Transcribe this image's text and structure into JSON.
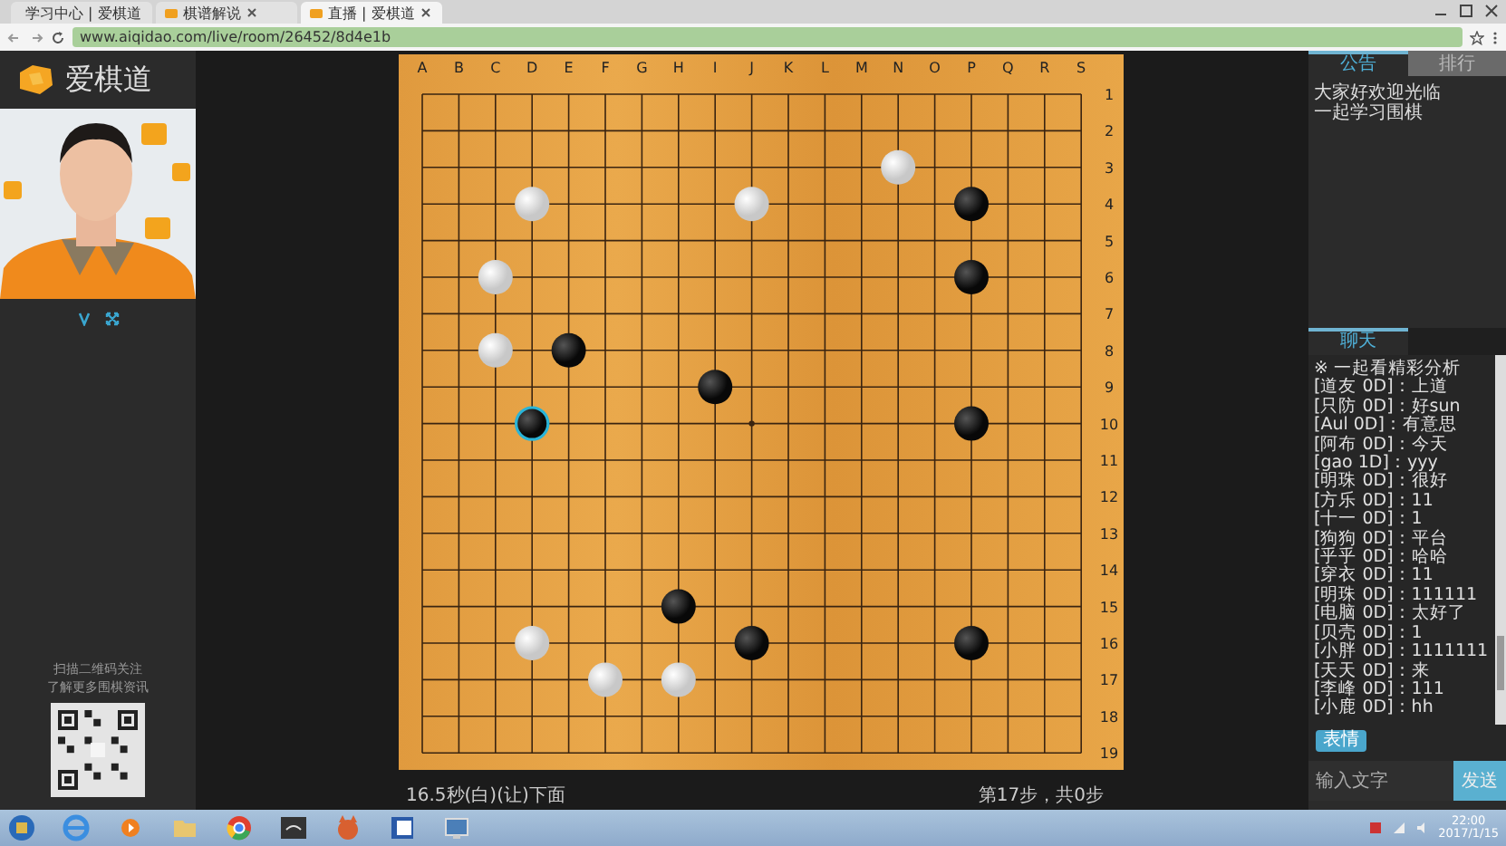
{
  "browser": {
    "tabs": [
      {
        "title": "学习中心 | 爱棋道",
        "selected": false
      },
      {
        "title": "棋谱解说",
        "selected": false
      },
      {
        "title": "直播 | 爱棋道",
        "selected": true
      }
    ],
    "address": "www.aiqidao.com/live/room/26452/8d4e1b"
  },
  "left_panel": {
    "logo": "爱棋道",
    "video": {
      "kind": "picture"
    },
    "qr_caption": [
      "扫描二维码关注",
      "了解更多围棋资讯"
    ]
  },
  "board": {
    "columns": [
      "A",
      "B",
      "C",
      "D",
      "E",
      "F",
      "G",
      "H",
      "I",
      "J",
      "K",
      "L",
      "M",
      "N",
      "O",
      "P",
      "Q",
      "R",
      "S"
    ],
    "rows": [
      "1",
      "2",
      "3",
      "4",
      "5",
      "6",
      "7",
      "8",
      "9",
      "10",
      "11",
      "12",
      "13",
      "14",
      "15",
      "16",
      "17",
      "18",
      "19"
    ],
    "grid": [
      {
        "points": [
          {
            "kind": "empty"
          },
          {
            "kind": "empty"
          },
          {
            "kind": "empty"
          },
          {
            "kind": "empty"
          },
          {
            "kind": "empty"
          },
          {
            "kind": "empty"
          },
          {
            "kind": "empty"
          },
          {
            "kind": "empty"
          },
          {
            "kind": "empty"
          },
          {
            "kind": "empty"
          },
          {
            "kind": "empty"
          },
          {
            "kind": "empty"
          },
          {
            "kind": "empty"
          },
          {
            "kind": "empty"
          },
          {
            "kind": "empty"
          },
          {
            "kind": "empty"
          },
          {
            "kind": "empty"
          },
          {
            "kind": "empty"
          },
          {
            "kind": "empty"
          }
        ]
      },
      {
        "points": [
          {
            "kind": "empty"
          },
          {
            "kind": "empty"
          },
          {
            "kind": "empty"
          },
          {
            "kind": "empty"
          },
          {
            "kind": "empty"
          },
          {
            "kind": "empty"
          },
          {
            "kind": "empty"
          },
          {
            "kind": "empty"
          },
          {
            "kind": "empty"
          },
          {
            "kind": "empty"
          },
          {
            "kind": "empty"
          },
          {
            "kind": "empty"
          },
          {
            "kind": "empty"
          },
          {
            "kind": "empty"
          },
          {
            "kind": "empty"
          },
          {
            "kind": "empty"
          },
          {
            "kind": "empty"
          },
          {
            "kind": "empty"
          },
          {
            "kind": "empty"
          }
        ]
      },
      {
        "points": [
          {
            "kind": "empty"
          },
          {
            "kind": "empty"
          },
          {
            "kind": "empty"
          },
          {
            "kind": "empty"
          },
          {
            "kind": "empty"
          },
          {
            "kind": "empty"
          },
          {
            "kind": "empty"
          },
          {
            "kind": "empty"
          },
          {
            "kind": "empty"
          },
          {
            "kind": "empty"
          },
          {
            "kind": "empty"
          },
          {
            "kind": "empty"
          },
          {
            "kind": "empty"
          },
          {
            "kind": "white"
          },
          {
            "kind": "empty"
          },
          {
            "kind": "empty"
          },
          {
            "kind": "empty"
          },
          {
            "kind": "empty"
          },
          {
            "kind": "empty"
          }
        ]
      },
      {
        "points": [
          {
            "kind": "empty"
          },
          {
            "kind": "empty"
          },
          {
            "kind": "empty"
          },
          {
            "kind": "white"
          },
          {
            "kind": "empty"
          },
          {
            "kind": "empty"
          },
          {
            "kind": "empty"
          },
          {
            "kind": "empty"
          },
          {
            "kind": "empty"
          },
          {
            "kind": "white"
          },
          {
            "kind": "empty"
          },
          {
            "kind": "empty"
          },
          {
            "kind": "empty"
          },
          {
            "kind": "empty"
          },
          {
            "kind": "empty"
          },
          {
            "kind": "black"
          },
          {
            "kind": "empty"
          },
          {
            "kind": "empty"
          },
          {
            "kind": "empty"
          }
        ]
      },
      {
        "points": [
          {
            "kind": "empty"
          },
          {
            "kind": "empty"
          },
          {
            "kind": "empty"
          },
          {
            "kind": "empty"
          },
          {
            "kind": "empty"
          },
          {
            "kind": "empty"
          },
          {
            "kind": "empty"
          },
          {
            "kind": "empty"
          },
          {
            "kind": "empty"
          },
          {
            "kind": "empty"
          },
          {
            "kind": "empty"
          },
          {
            "kind": "empty"
          },
          {
            "kind": "empty"
          },
          {
            "kind": "empty"
          },
          {
            "kind": "empty"
          },
          {
            "kind": "empty"
          },
          {
            "kind": "empty"
          },
          {
            "kind": "empty"
          },
          {
            "kind": "empty"
          }
        ]
      },
      {
        "points": [
          {
            "kind": "empty"
          },
          {
            "kind": "empty"
          },
          {
            "kind": "white"
          },
          {
            "kind": "empty"
          },
          {
            "kind": "empty"
          },
          {
            "kind": "empty"
          },
          {
            "kind": "empty"
          },
          {
            "kind": "empty"
          },
          {
            "kind": "empty"
          },
          {
            "kind": "empty"
          },
          {
            "kind": "empty"
          },
          {
            "kind": "empty"
          },
          {
            "kind": "empty"
          },
          {
            "kind": "empty"
          },
          {
            "kind": "empty"
          },
          {
            "kind": "black"
          },
          {
            "kind": "empty"
          },
          {
            "kind": "empty"
          },
          {
            "kind": "empty"
          }
        ]
      },
      {
        "points": [
          {
            "kind": "empty"
          },
          {
            "kind": "empty"
          },
          {
            "kind": "empty"
          },
          {
            "kind": "empty"
          },
          {
            "kind": "empty"
          },
          {
            "kind": "empty"
          },
          {
            "kind": "empty"
          },
          {
            "kind": "empty"
          },
          {
            "kind": "empty"
          },
          {
            "kind": "empty"
          },
          {
            "kind": "empty"
          },
          {
            "kind": "empty"
          },
          {
            "kind": "empty"
          },
          {
            "kind": "empty"
          },
          {
            "kind": "empty"
          },
          {
            "kind": "empty"
          },
          {
            "kind": "empty"
          },
          {
            "kind": "empty"
          },
          {
            "kind": "empty"
          }
        ]
      },
      {
        "points": [
          {
            "kind": "empty"
          },
          {
            "kind": "empty"
          },
          {
            "kind": "white"
          },
          {
            "kind": "empty"
          },
          {
            "kind": "black"
          },
          {
            "kind": "empty"
          },
          {
            "kind": "empty"
          },
          {
            "kind": "empty"
          },
          {
            "kind": "empty"
          },
          {
            "kind": "empty"
          },
          {
            "kind": "empty"
          },
          {
            "kind": "empty"
          },
          {
            "kind": "empty"
          },
          {
            "kind": "empty"
          },
          {
            "kind": "empty"
          },
          {
            "kind": "empty"
          },
          {
            "kind": "empty"
          },
          {
            "kind": "empty"
          },
          {
            "kind": "empty"
          }
        ]
      },
      {
        "points": [
          {
            "kind": "empty"
          },
          {
            "kind": "empty"
          },
          {
            "kind": "empty"
          },
          {
            "kind": "empty"
          },
          {
            "kind": "empty"
          },
          {
            "kind": "empty"
          },
          {
            "kind": "empty"
          },
          {
            "kind": "empty"
          },
          {
            "kind": "black"
          },
          {
            "kind": "empty"
          },
          {
            "kind": "empty"
          },
          {
            "kind": "empty"
          },
          {
            "kind": "empty"
          },
          {
            "kind": "empty"
          },
          {
            "kind": "empty"
          },
          {
            "kind": "empty"
          },
          {
            "kind": "empty"
          },
          {
            "kind": "empty"
          },
          {
            "kind": "empty"
          }
        ]
      },
      {
        "points": [
          {
            "kind": "empty"
          },
          {
            "kind": "empty"
          },
          {
            "kind": "empty"
          },
          {
            "kind": "lastblack"
          },
          {
            "kind": "empty"
          },
          {
            "kind": "empty"
          },
          {
            "kind": "empty"
          },
          {
            "kind": "empty"
          },
          {
            "kind": "empty"
          },
          {
            "kind": "empty"
          },
          {
            "kind": "empty"
          },
          {
            "kind": "empty"
          },
          {
            "kind": "empty"
          },
          {
            "kind": "empty"
          },
          {
            "kind": "empty"
          },
          {
            "kind": "black"
          },
          {
            "kind": "empty"
          },
          {
            "kind": "empty"
          },
          {
            "kind": "empty"
          }
        ]
      },
      {
        "points": [
          {
            "kind": "empty"
          },
          {
            "kind": "empty"
          },
          {
            "kind": "empty"
          },
          {
            "kind": "empty"
          },
          {
            "kind": "empty"
          },
          {
            "kind": "empty"
          },
          {
            "kind": "empty"
          },
          {
            "kind": "empty"
          },
          {
            "kind": "empty"
          },
          {
            "kind": "empty"
          },
          {
            "kind": "empty"
          },
          {
            "kind": "empty"
          },
          {
            "kind": "empty"
          },
          {
            "kind": "empty"
          },
          {
            "kind": "empty"
          },
          {
            "kind": "empty"
          },
          {
            "kind": "empty"
          },
          {
            "kind": "empty"
          },
          {
            "kind": "empty"
          }
        ]
      },
      {
        "points": [
          {
            "kind": "empty"
          },
          {
            "kind": "empty"
          },
          {
            "kind": "empty"
          },
          {
            "kind": "empty"
          },
          {
            "kind": "empty"
          },
          {
            "kind": "empty"
          },
          {
            "kind": "empty"
          },
          {
            "kind": "empty"
          },
          {
            "kind": "empty"
          },
          {
            "kind": "empty"
          },
          {
            "kind": "empty"
          },
          {
            "kind": "empty"
          },
          {
            "kind": "empty"
          },
          {
            "kind": "empty"
          },
          {
            "kind": "empty"
          },
          {
            "kind": "empty"
          },
          {
            "kind": "empty"
          },
          {
            "kind": "empty"
          },
          {
            "kind": "empty"
          }
        ]
      },
      {
        "points": [
          {
            "kind": "empty"
          },
          {
            "kind": "empty"
          },
          {
            "kind": "empty"
          },
          {
            "kind": "empty"
          },
          {
            "kind": "empty"
          },
          {
            "kind": "empty"
          },
          {
            "kind": "empty"
          },
          {
            "kind": "empty"
          },
          {
            "kind": "empty"
          },
          {
            "kind": "empty"
          },
          {
            "kind": "empty"
          },
          {
            "kind": "empty"
          },
          {
            "kind": "empty"
          },
          {
            "kind": "empty"
          },
          {
            "kind": "empty"
          },
          {
            "kind": "empty"
          },
          {
            "kind": "empty"
          },
          {
            "kind": "empty"
          },
          {
            "kind": "empty"
          }
        ]
      },
      {
        "points": [
          {
            "kind": "empty"
          },
          {
            "kind": "empty"
          },
          {
            "kind": "empty"
          },
          {
            "kind": "empty"
          },
          {
            "kind": "empty"
          },
          {
            "kind": "empty"
          },
          {
            "kind": "empty"
          },
          {
            "kind": "empty"
          },
          {
            "kind": "empty"
          },
          {
            "kind": "empty"
          },
          {
            "kind": "empty"
          },
          {
            "kind": "empty"
          },
          {
            "kind": "empty"
          },
          {
            "kind": "empty"
          },
          {
            "kind": "empty"
          },
          {
            "kind": "empty"
          },
          {
            "kind": "empty"
          },
          {
            "kind": "empty"
          },
          {
            "kind": "empty"
          }
        ]
      },
      {
        "points": [
          {
            "kind": "empty"
          },
          {
            "kind": "empty"
          },
          {
            "kind": "empty"
          },
          {
            "kind": "empty"
          },
          {
            "kind": "empty"
          },
          {
            "kind": "empty"
          },
          {
            "kind": "empty"
          },
          {
            "kind": "black"
          },
          {
            "kind": "empty"
          },
          {
            "kind": "empty"
          },
          {
            "kind": "empty"
          },
          {
            "kind": "empty"
          },
          {
            "kind": "empty"
          },
          {
            "kind": "empty"
          },
          {
            "kind": "empty"
          },
          {
            "kind": "empty"
          },
          {
            "kind": "empty"
          },
          {
            "kind": "empty"
          },
          {
            "kind": "empty"
          }
        ]
      },
      {
        "points": [
          {
            "kind": "empty"
          },
          {
            "kind": "empty"
          },
          {
            "kind": "empty"
          },
          {
            "kind": "white"
          },
          {
            "kind": "empty"
          },
          {
            "kind": "empty"
          },
          {
            "kind": "empty"
          },
          {
            "kind": "empty"
          },
          {
            "kind": "empty"
          },
          {
            "kind": "black"
          },
          {
            "kind": "empty"
          },
          {
            "kind": "empty"
          },
          {
            "kind": "empty"
          },
          {
            "kind": "empty"
          },
          {
            "kind": "empty"
          },
          {
            "kind": "black"
          },
          {
            "kind": "empty"
          },
          {
            "kind": "empty"
          },
          {
            "kind": "empty"
          }
        ]
      },
      {
        "points": [
          {
            "kind": "empty"
          },
          {
            "kind": "empty"
          },
          {
            "kind": "empty"
          },
          {
            "kind": "empty"
          },
          {
            "kind": "empty"
          },
          {
            "kind": "white"
          },
          {
            "kind": "empty"
          },
          {
            "kind": "white"
          },
          {
            "kind": "empty"
          },
          {
            "kind": "empty"
          },
          {
            "kind": "empty"
          },
          {
            "kind": "empty"
          },
          {
            "kind": "empty"
          },
          {
            "kind": "empty"
          },
          {
            "kind": "empty"
          },
          {
            "kind": "empty"
          },
          {
            "kind": "empty"
          },
          {
            "kind": "empty"
          },
          {
            "kind": "empty"
          }
        ]
      },
      {
        "points": [
          {
            "kind": "empty"
          },
          {
            "kind": "empty"
          },
          {
            "kind": "empty"
          },
          {
            "kind": "empty"
          },
          {
            "kind": "empty"
          },
          {
            "kind": "empty"
          },
          {
            "kind": "empty"
          },
          {
            "kind": "empty"
          },
          {
            "kind": "empty"
          },
          {
            "kind": "empty"
          },
          {
            "kind": "empty"
          },
          {
            "kind": "empty"
          },
          {
            "kind": "empty"
          },
          {
            "kind": "empty"
          },
          {
            "kind": "empty"
          },
          {
            "kind": "empty"
          },
          {
            "kind": "empty"
          },
          {
            "kind": "empty"
          },
          {
            "kind": "empty"
          }
        ]
      },
      {
        "points": [
          {
            "kind": "empty"
          },
          {
            "kind": "empty"
          },
          {
            "kind": "empty"
          },
          {
            "kind": "empty"
          },
          {
            "kind": "empty"
          },
          {
            "kind": "empty"
          },
          {
            "kind": "empty"
          },
          {
            "kind": "empty"
          },
          {
            "kind": "empty"
          },
          {
            "kind": "empty"
          },
          {
            "kind": "empty"
          },
          {
            "kind": "empty"
          },
          {
            "kind": "empty"
          },
          {
            "kind": "empty"
          },
          {
            "kind": "empty"
          },
          {
            "kind": "empty"
          },
          {
            "kind": "empty"
          },
          {
            "kind": "empty"
          },
          {
            "kind": "empty"
          }
        ]
      }
    ],
    "status_left": "16.5秒(白)(让)下面",
    "status_right": "第17步，共0步"
  },
  "right_panel": {
    "tabs": [
      {
        "label": "公告",
        "selected": true
      },
      {
        "label": "排行",
        "selected": false
      }
    ],
    "notice": [
      "大家好欢迎光临",
      "一起学习围棋"
    ],
    "chat_tabs": [
      {
        "label": "聊天",
        "selected": true
      }
    ],
    "messages": [
      "※ 一起看精彩分析",
      "[道友 0D]：上道",
      "[只防 0D]：好sun",
      "[Aul 0D]：有意思",
      "[阿布 0D]：今天",
      "[gao 1D]：yyy",
      "[明珠 0D]：很好",
      "[方乐 0D]：11",
      "[十一 0D]：1",
      "[狗狗 0D]：平台",
      "[乎乎 0D]：哈哈",
      "[穿衣 0D]：11",
      "[明珠 0D]：111111",
      "[电脑 0D]：太好了",
      "[贝壳 0D]：1",
      "[小胖 0D]：1111111",
      "[天天 0D]：来",
      "[李峰 0D]：111",
      "[小鹿 0D]：hh"
    ],
    "emoji_button": "表情",
    "input_placeholder": "输入文字",
    "send_button": "发送"
  },
  "taskbar": {
    "time": "22:00",
    "date": "2017/1/15"
  }
}
